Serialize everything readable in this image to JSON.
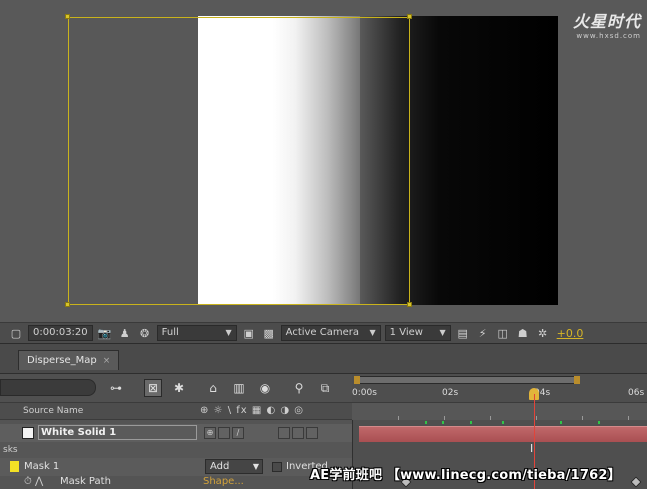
{
  "watermark": {
    "logo_text": "火星时代",
    "logo_url_text": "www.hxsd.com"
  },
  "viewer_toolbar": {
    "timecode": "0:00:03:20",
    "resolution": "Full",
    "camera": "Active Camera",
    "view_layout": "1 View",
    "exposure": "+0.0"
  },
  "timeline": {
    "tab_label": "Disperse_Map",
    "tab_close": "×",
    "time_ruler": {
      "labels": [
        "0:00s",
        "02s",
        "04s",
        "06s"
      ]
    },
    "column_header": {
      "source_name": "Source Name",
      "switches": "⊕ ☼ \\ fx ▦ ◐ ◑ ◎"
    },
    "layer": {
      "name": "White Solid 1"
    },
    "masks_group_label": "sks",
    "mask": {
      "name": "Mask 1",
      "mode": "Add",
      "inverted_label": "Inverted"
    },
    "mask_path": {
      "label": "Mask Path",
      "value": "Shape..."
    }
  },
  "caption": "AE学前班吧 【www.linecg.com/tieba/1762】",
  "colors": {
    "accent_yellow": "#c9b31c",
    "layer_bar": "#b35a5c",
    "cti": "#e2443a",
    "mask_swatch": "#f3e125"
  }
}
